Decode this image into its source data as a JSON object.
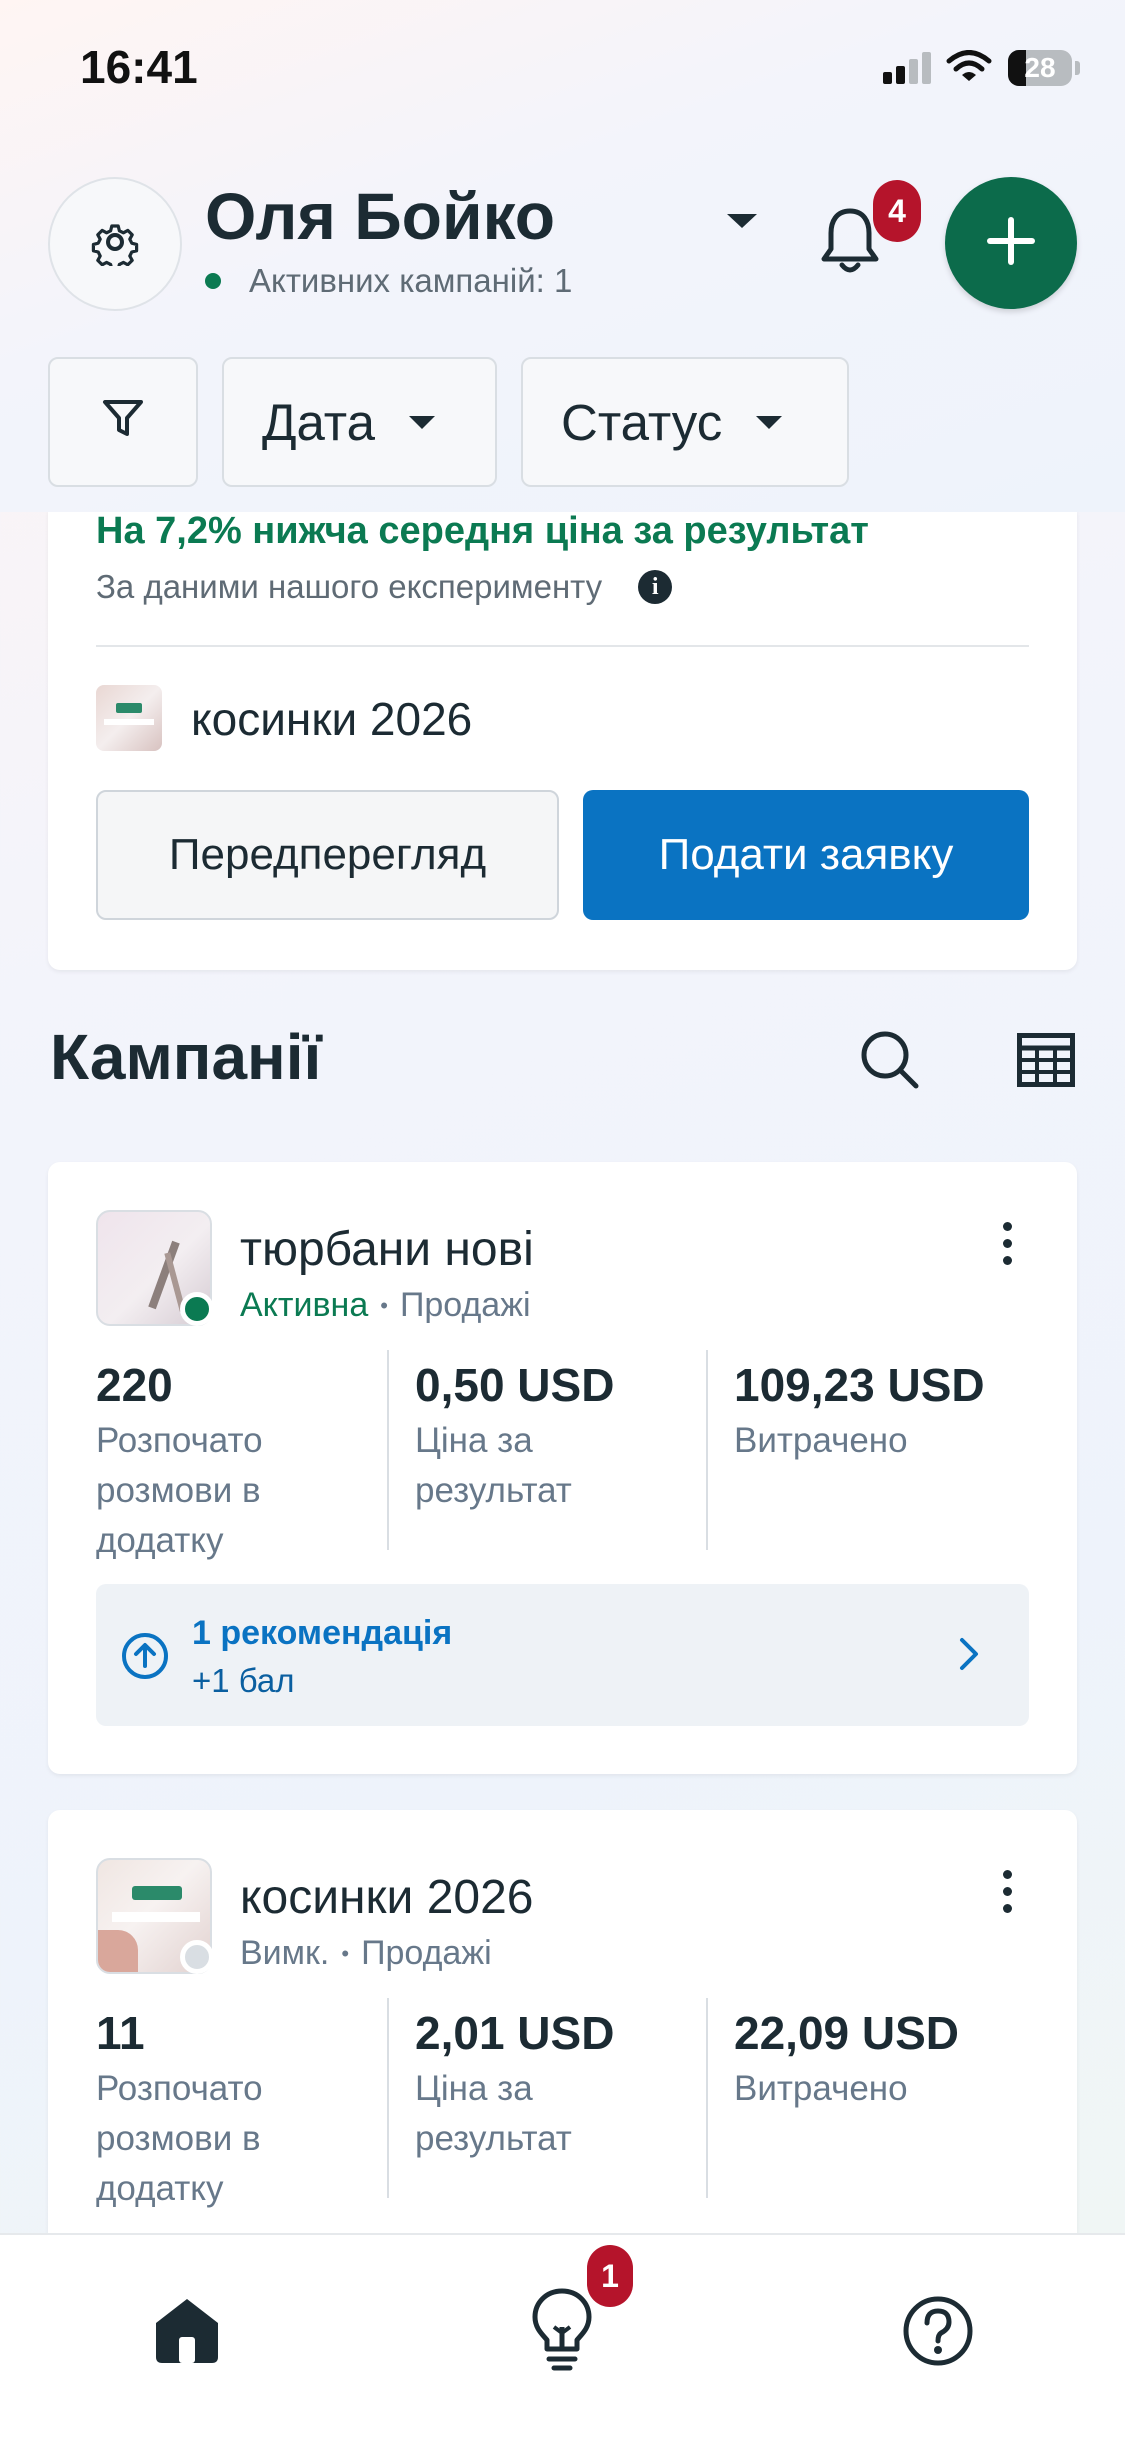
{
  "status_bar": {
    "time": "16:41",
    "battery": "28"
  },
  "header": {
    "user_name": "Оля Бойко",
    "active_campaigns": "Активних кампаній: 1",
    "notifications_count": "4"
  },
  "filters": {
    "date": "Дата",
    "status": "Статус"
  },
  "promo": {
    "headline": "На 7,2% нижча середня ціна за результат",
    "subtext": "За даними нашого експерименту",
    "campaign_name": "косинки 2026",
    "preview_button": "Передперегляд",
    "submit_button": "Подати заявку"
  },
  "campaigns_section": {
    "title": "Кампанії"
  },
  "campaigns": [
    {
      "name": "тюрбани нові",
      "status": "Активна",
      "objective": "Продажі",
      "status_color": "#0b7a52",
      "metrics": [
        {
          "value": "220",
          "label": "Розпочато розмови в додатку"
        },
        {
          "value": "0,50 USD",
          "label": "Ціна за результат"
        },
        {
          "value": "109,23 USD",
          "label": "Витрачено"
        }
      ],
      "recommendation": {
        "title": "1 рекомендація",
        "subtitle": "+1 бал"
      }
    },
    {
      "name": "косинки 2026",
      "status": "Вимк.",
      "objective": "Продажі",
      "status_color": "#67788a",
      "metrics": [
        {
          "value": "11",
          "label": "Розпочато розмови в додатку"
        },
        {
          "value": "2,01 USD",
          "label": "Ціна за результат"
        },
        {
          "value": "22,09 USD",
          "label": "Витрачено"
        }
      ]
    }
  ],
  "bottom_nav": {
    "ideas_badge": "1"
  },
  "colors": {
    "accent_green": "#0c6b4b",
    "primary_blue": "#0a73c2",
    "badge_red": "#b5142b",
    "link_blue": "#0a73c2"
  }
}
